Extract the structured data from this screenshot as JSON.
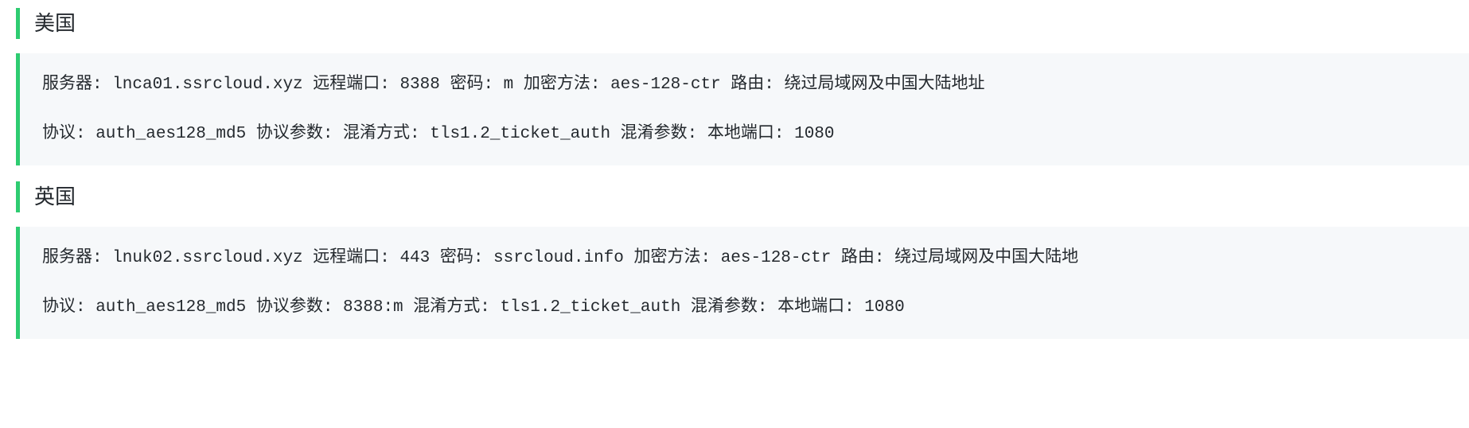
{
  "sections": [
    {
      "title": "美国",
      "lines": [
        "服务器: lnca01.ssrcloud.xyz 远程端口: 8388 密码: m 加密方法: aes-128-ctr 路由: 绕过局域网及中国大陆地址",
        "协议: auth_aes128_md5 协议参数:  混淆方式: tls1.2_ticket_auth 混淆参数:  本地端口: 1080"
      ]
    },
    {
      "title": "英国",
      "lines": [
        "服务器: lnuk02.ssrcloud.xyz 远程端口: 443 密码: ssrcloud.info 加密方法: aes-128-ctr 路由: 绕过局域网及中国大陆地",
        "协议: auth_aes128_md5 协议参数: 8388:m 混淆方式: tls1.2_ticket_auth 混淆参数:  本地端口: 1080"
      ]
    }
  ]
}
